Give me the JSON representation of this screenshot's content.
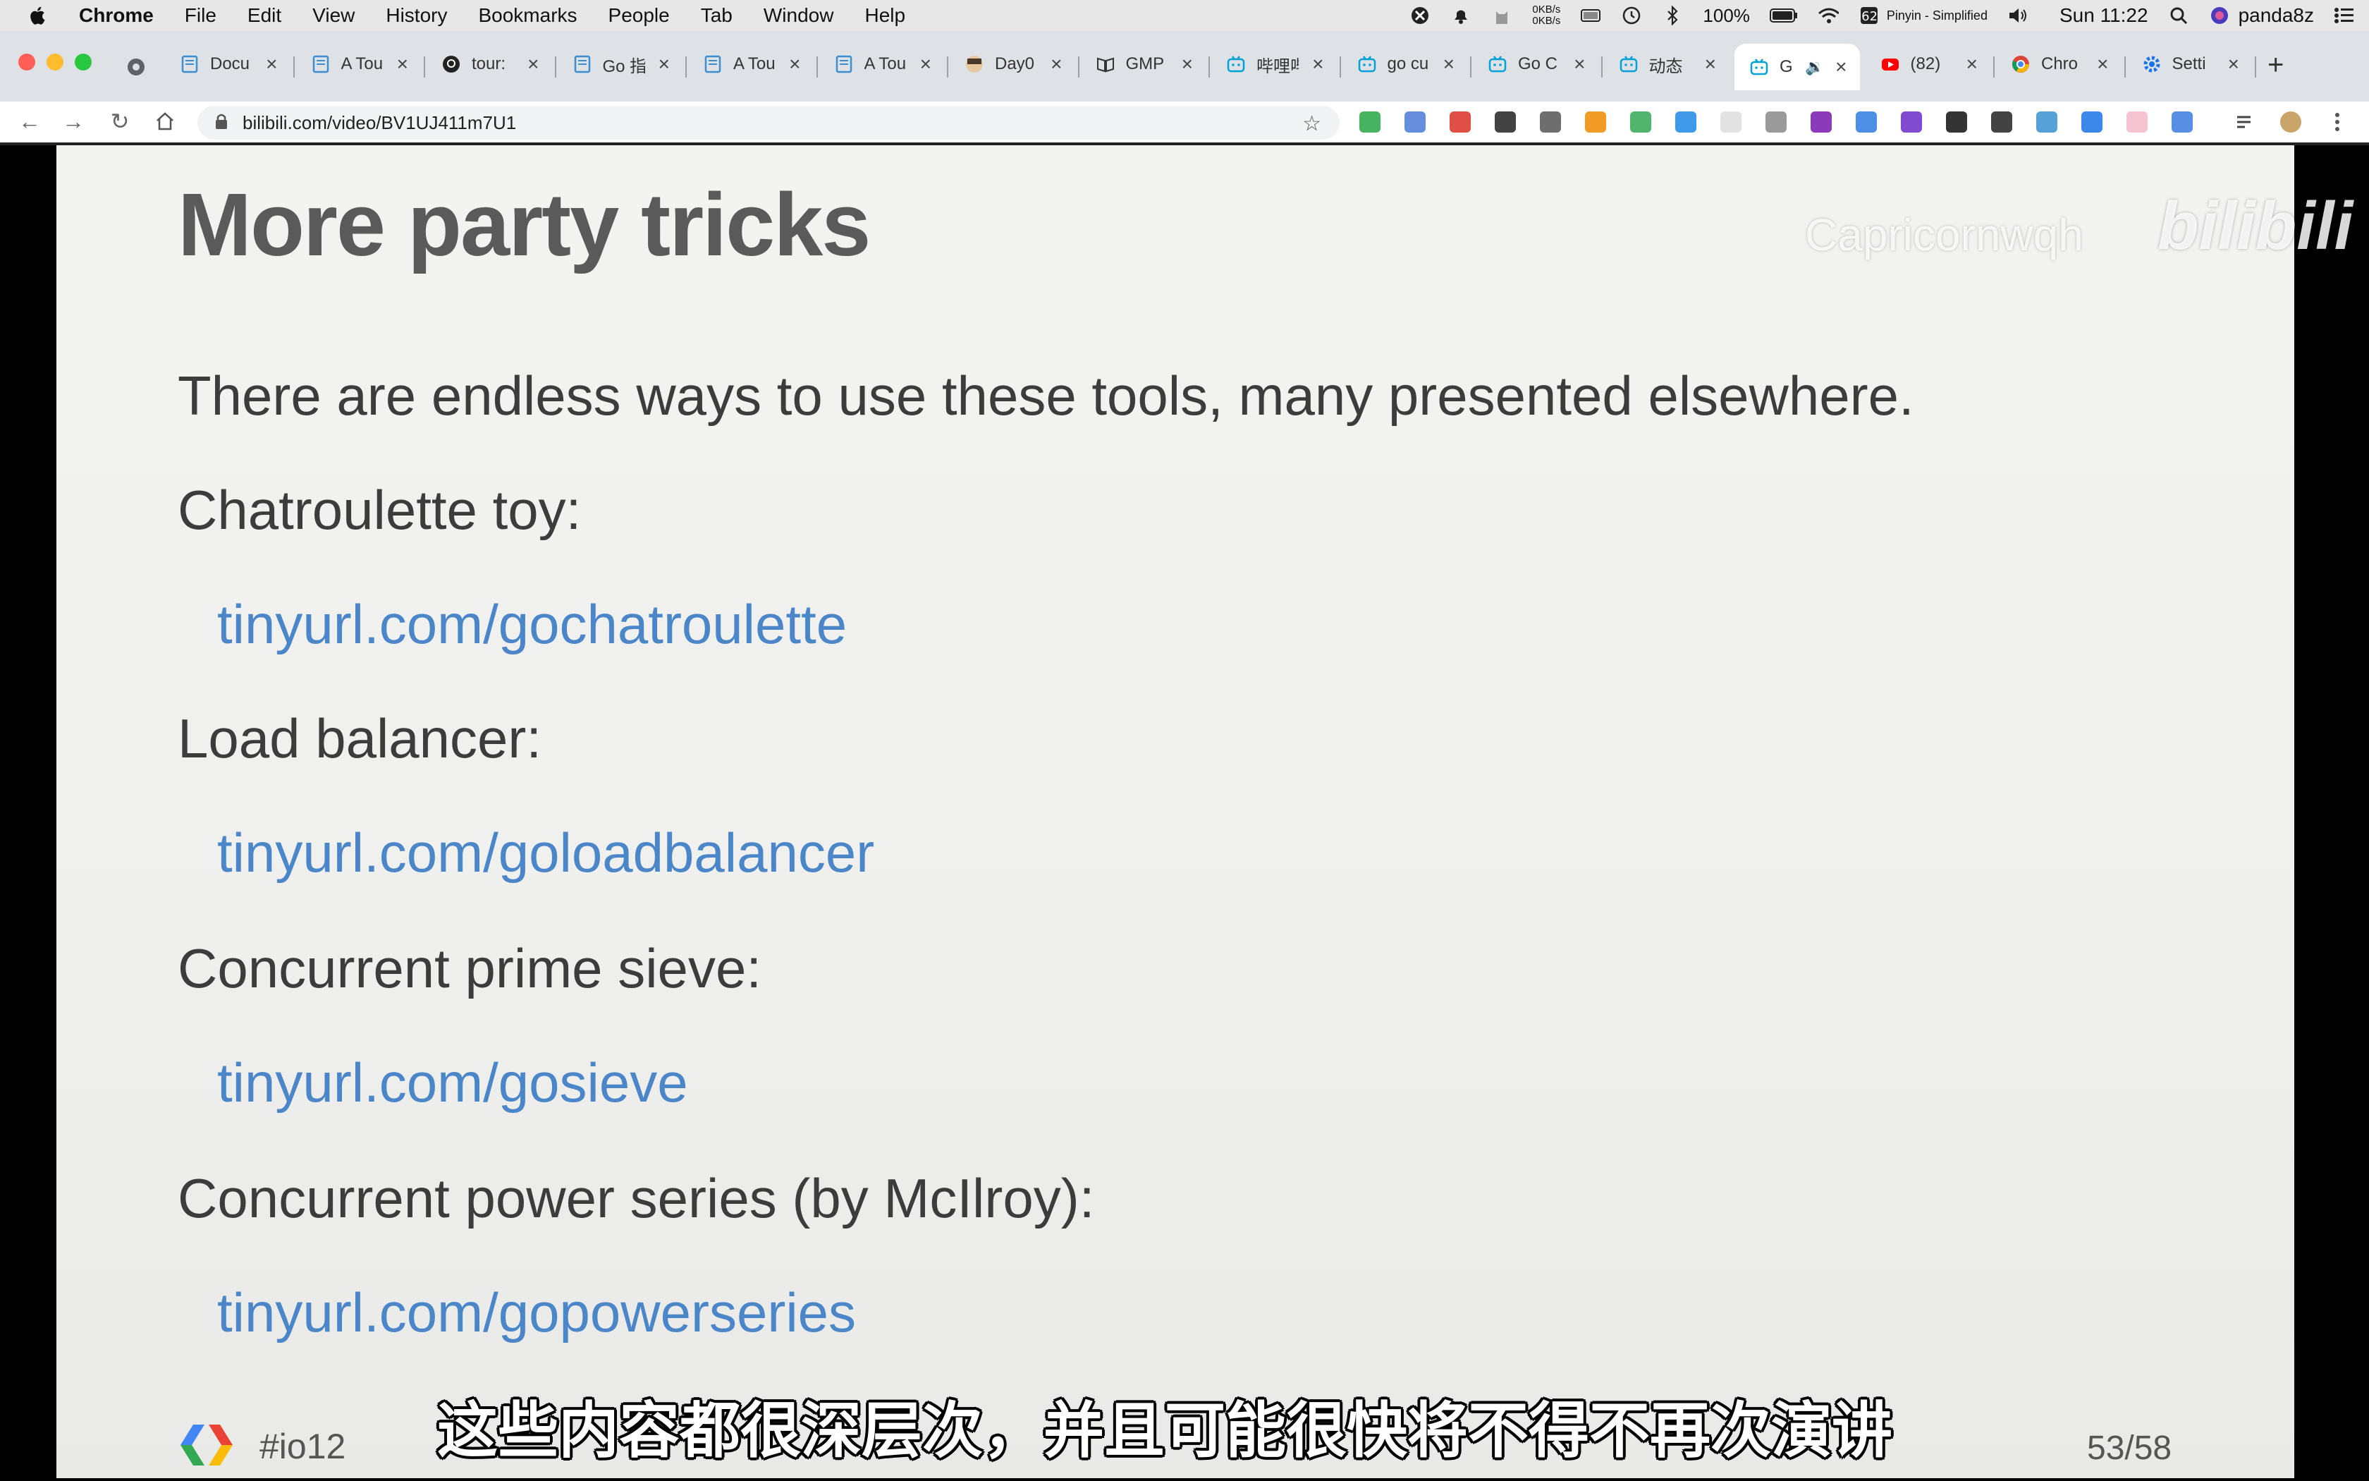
{
  "menubar": {
    "app": "Chrome",
    "items": [
      "File",
      "Edit",
      "View",
      "History",
      "Bookmarks",
      "People",
      "Tab",
      "Window",
      "Help"
    ],
    "status": {
      "net_up": "0KB/s",
      "net_down": "0KB/s",
      "battery": "100%",
      "input_method": "Pinyin - Simplified",
      "clock": "Sun 11:22",
      "user": "panda8z"
    }
  },
  "tabs": [
    {
      "title": "Docu",
      "icon": "page-icon"
    },
    {
      "title": "A Tou",
      "icon": "page-icon"
    },
    {
      "title": "tour:",
      "icon": "github-icon"
    },
    {
      "title": "Go 指",
      "icon": "page-icon"
    },
    {
      "title": "A Tou",
      "icon": "page-icon"
    },
    {
      "title": "A Tou",
      "icon": "page-icon"
    },
    {
      "title": "Day0",
      "icon": "avatar-icon"
    },
    {
      "title": "GMP",
      "icon": "book-icon"
    },
    {
      "title": "哔哩哔",
      "icon": "bilibili-icon"
    },
    {
      "title": "go cu",
      "icon": "bilibili-icon"
    },
    {
      "title": "Go C",
      "icon": "bilibili-icon"
    },
    {
      "title": "动态",
      "icon": "bilibili-icon"
    },
    {
      "title": "G",
      "icon": "bilibili-icon",
      "active": true
    },
    {
      "title": "(82)",
      "icon": "youtube-icon"
    },
    {
      "title": "Chro",
      "icon": "chrome-icon"
    },
    {
      "title": "Setti",
      "icon": "gear-icon"
    }
  ],
  "toolbar": {
    "url": "bilibili.com/video/BV1UJ411m7U1"
  },
  "slide": {
    "title": "More party tricks",
    "intro": "There are endless ways to use these tools, many presented elsewhere.",
    "items": [
      {
        "label": "Chatroulette toy:",
        "link": "tinyurl.com/gochatroulette"
      },
      {
        "label": "Load balancer:",
        "link": "tinyurl.com/goloadbalancer"
      },
      {
        "label": "Concurrent prime sieve:",
        "link": "tinyurl.com/gosieve"
      },
      {
        "label": "Concurrent power series (by McIlroy):",
        "link": "tinyurl.com/gopowerseries"
      }
    ],
    "tag": "#io12",
    "page": "53/58"
  },
  "overlay": {
    "watermark": "Capricornwqh",
    "site_logo": "bilibili",
    "subtitle": "这些内容都很深层次，并且可能很快将不得不再次演讲"
  }
}
